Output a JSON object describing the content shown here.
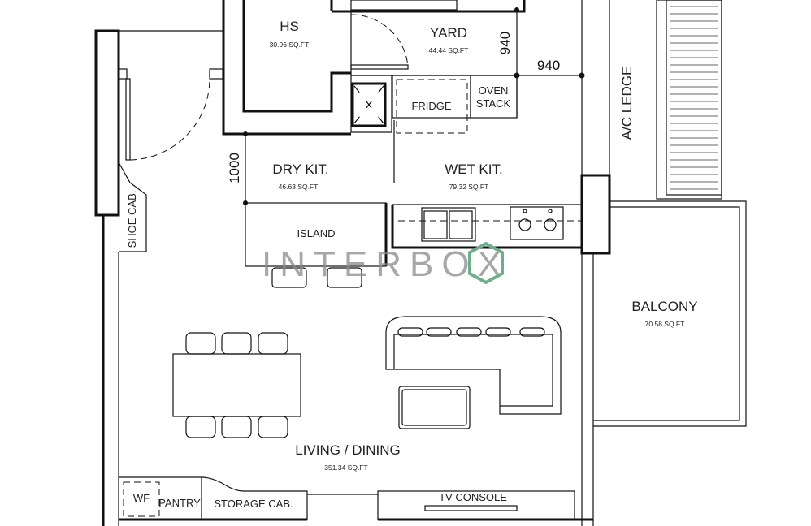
{
  "rooms": {
    "hs": {
      "label": "HS",
      "area": "30.96 SQ.FT"
    },
    "yard": {
      "label": "YARD",
      "area": "44.44 SQ.FT"
    },
    "dry_kit": {
      "label": "DRY KIT.",
      "area": "46.63 SQ.FT"
    },
    "wet_kit": {
      "label": "WET KIT.",
      "area": "79.32 SQ.FT"
    },
    "balcony": {
      "label": "BALCONY",
      "area": "70.58 SQ.FT"
    },
    "living": {
      "label": "LIVING / DINING",
      "area": "351.34 SQ.FT"
    }
  },
  "fixtures": {
    "fridge": "FRIDGE",
    "oven_line1": "OVEN",
    "oven_line2": "STACK",
    "island": "ISLAND",
    "shoe_cab": "SHOE CAB.",
    "ac_ledge": "A/C LEDGE",
    "wf": "WF",
    "pantry": "PANTRY",
    "storage_cab": "STORAGE CAB.",
    "tv_console": "TV CONSOLE"
  },
  "dimensions": {
    "yard_vertical": "940",
    "yard_horizontal": "940",
    "dry_kit": "1000"
  },
  "watermark": "INTERBOX"
}
